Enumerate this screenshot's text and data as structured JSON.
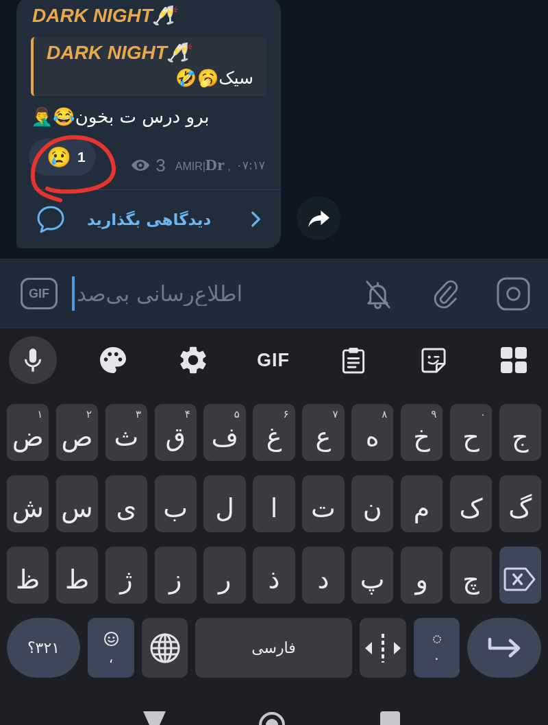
{
  "message": {
    "sender": "DARK NIGHT🥂",
    "reply": {
      "sender": "DARK NIGHT🥂",
      "text": "سیک🥱🤣"
    },
    "text": "برو درس ت بخون😂🤦‍♂️",
    "reactions": [
      {
        "emoji": "😢",
        "count": "1"
      }
    ],
    "views": "3",
    "signature": "AMIR|**Dr** ,",
    "time": "۰۷:۱۷",
    "comments": "دیدگاهی بگذارید"
  },
  "composer": {
    "gif_label": "GIF",
    "placeholder": "اطلاع‌رسانی بی‌صد"
  },
  "keyboard": {
    "toolbar": [
      {
        "kind": "mic"
      },
      {
        "kind": "palette"
      },
      {
        "kind": "settings"
      },
      {
        "kind": "gif",
        "label": "GIF"
      },
      {
        "kind": "clipboard"
      },
      {
        "kind": "sticker"
      },
      {
        "kind": "grid"
      }
    ],
    "rows": [
      [
        {
          "kind": "letter",
          "char": "ج"
        },
        {
          "kind": "letter",
          "char": "ح",
          "hint": "۰"
        },
        {
          "kind": "letter",
          "char": "خ",
          "hint": "۹"
        },
        {
          "kind": "letter",
          "char": "ه",
          "hint": "۸"
        },
        {
          "kind": "letter",
          "char": "ع",
          "hint": "۷"
        },
        {
          "kind": "letter",
          "char": "غ",
          "hint": "۶"
        },
        {
          "kind": "letter",
          "char": "ف",
          "hint": "۵"
        },
        {
          "kind": "letter",
          "char": "ق",
          "hint": "۴"
        },
        {
          "kind": "letter",
          "char": "ث",
          "hint": "۳"
        },
        {
          "kind": "letter",
          "char": "ص",
          "hint": "۲"
        },
        {
          "kind": "letter",
          "char": "ض",
          "hint": "۱"
        }
      ],
      [
        {
          "kind": "letter",
          "char": "گ"
        },
        {
          "kind": "letter",
          "char": "ک"
        },
        {
          "kind": "letter",
          "char": "م"
        },
        {
          "kind": "letter",
          "char": "ن"
        },
        {
          "kind": "letter",
          "char": "ت"
        },
        {
          "kind": "letter",
          "char": "ا"
        },
        {
          "kind": "letter",
          "char": "ل"
        },
        {
          "kind": "letter",
          "char": "ب"
        },
        {
          "kind": "letter",
          "char": "ی"
        },
        {
          "kind": "letter",
          "char": "س"
        },
        {
          "kind": "letter",
          "char": "ش"
        }
      ],
      [
        {
          "kind": "backspace"
        },
        {
          "kind": "letter",
          "char": "چ"
        },
        {
          "kind": "letter",
          "char": "و"
        },
        {
          "kind": "letter",
          "char": "پ"
        },
        {
          "kind": "letter",
          "char": "د"
        },
        {
          "kind": "letter",
          "char": "ذ"
        },
        {
          "kind": "letter",
          "char": "ر"
        },
        {
          "kind": "letter",
          "char": "ز"
        },
        {
          "kind": "letter",
          "char": "ژ"
        },
        {
          "kind": "letter",
          "char": "ط"
        },
        {
          "kind": "letter",
          "char": "ظ"
        }
      ]
    ],
    "bottom_row": [
      {
        "kind": "enter"
      },
      {
        "kind": "period",
        "label": "."
      },
      {
        "kind": "cursor"
      },
      {
        "kind": "space",
        "label": "فارسی"
      },
      {
        "kind": "globe"
      },
      {
        "kind": "emoji-comma",
        "label": "،"
      },
      {
        "kind": "symbols",
        "label": "؟۳۲۱"
      }
    ]
  }
}
